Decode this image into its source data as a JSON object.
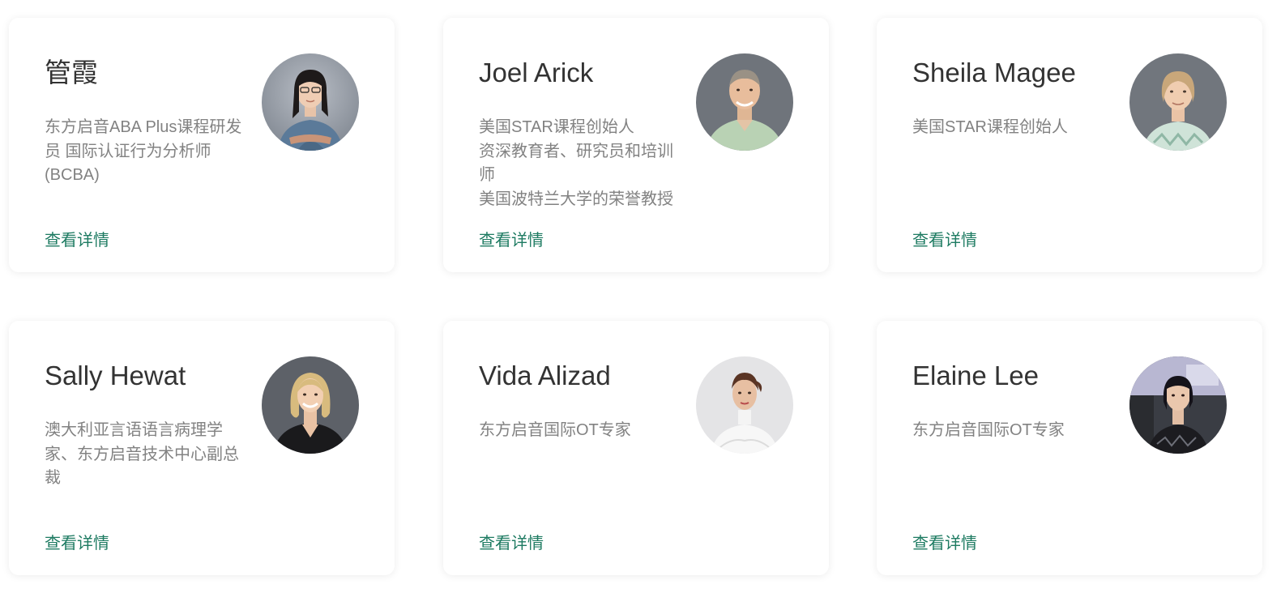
{
  "detail_label": "查看详情",
  "cards": [
    {
      "name": "管霞",
      "description": "东方启音ABA Plus课程研发员 国际认证行为分析师(BCBA)",
      "avatar": "person-photo-woman-glasses"
    },
    {
      "name": "Joel Arick",
      "description": "美国STAR课程创始人\n资深教育者、研究员和培训师\n美国波特兰大学的荣誉教授",
      "avatar": "person-photo-older-man"
    },
    {
      "name": "Sheila Magee",
      "description": "美国STAR课程创始人",
      "avatar": "person-photo-older-woman"
    },
    {
      "name": "Sally Hewat",
      "description": "澳大利亚言语语言病理学家、东方启音技术中心副总裁",
      "avatar": "person-photo-blonde-woman"
    },
    {
      "name": "Vida Alizad",
      "description": "东方启音国际OT专家",
      "avatar": "person-photo-woman-white-top"
    },
    {
      "name": "Elaine Lee",
      "description": "东方启音国际OT专家",
      "avatar": "person-photo-young-woman"
    }
  ],
  "colors": {
    "link": "#1e7b62",
    "name_text": "#333333",
    "description_text": "#828282",
    "card_background": "#ffffff"
  }
}
